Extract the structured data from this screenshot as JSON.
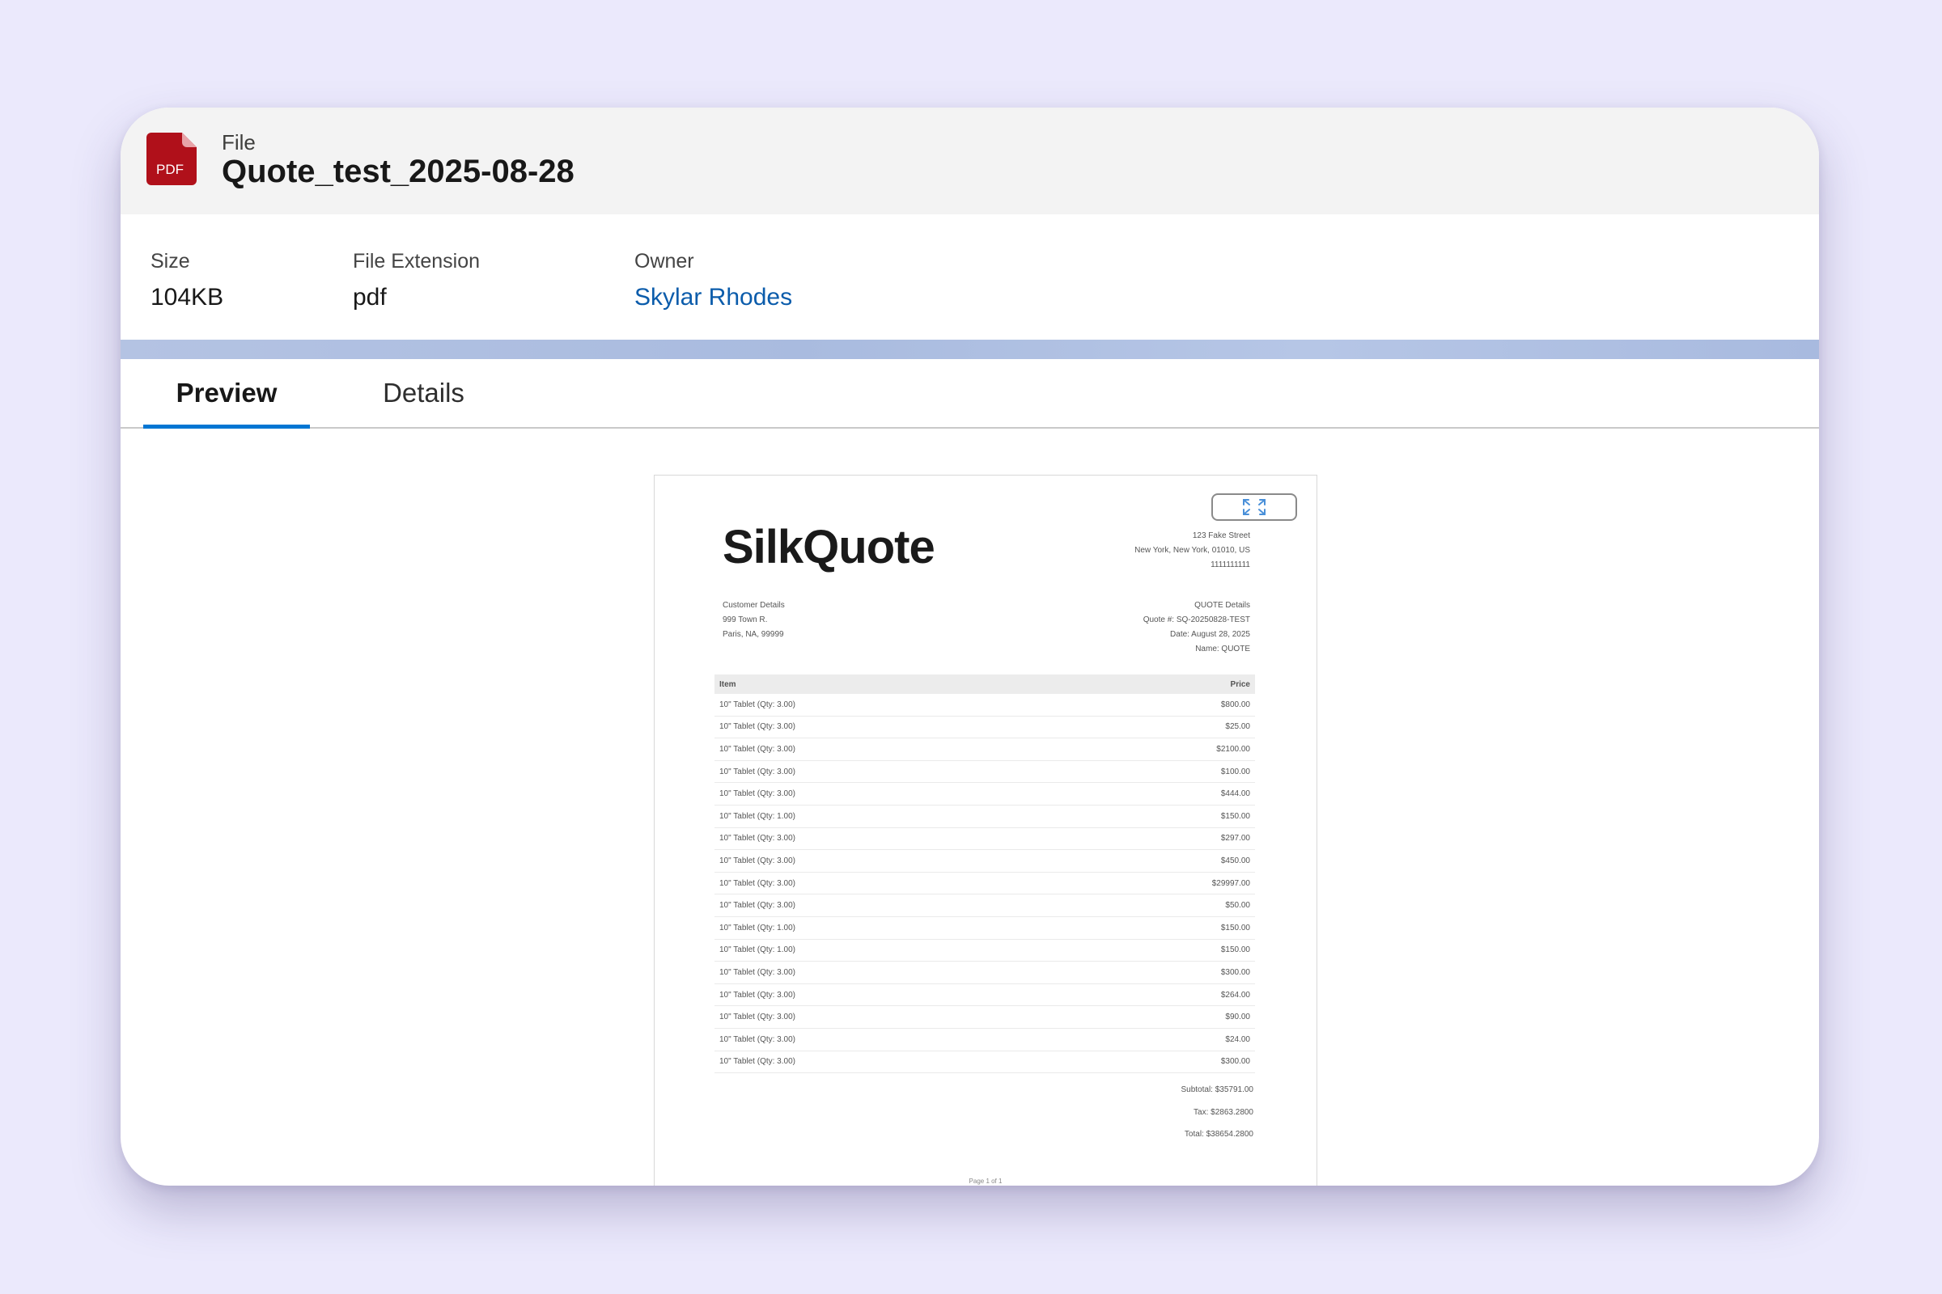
{
  "header": {
    "object_type": "File",
    "title": "Quote_test_2025-08-28",
    "icon": "pdf-file-icon",
    "icon_label": "PDF",
    "icon_color": "#b0101a"
  },
  "fields": [
    {
      "label": "Size",
      "value": "104KB"
    },
    {
      "label": "File Extension",
      "value": "pdf"
    },
    {
      "label": "Owner",
      "value": "Skylar Rhodes",
      "is_link": true
    }
  ],
  "tabs": [
    {
      "label": "Preview",
      "active": true
    },
    {
      "label": "Details",
      "active": false
    }
  ],
  "accent_color": "#0176d3",
  "preview": {
    "brand": "SilkQuote",
    "company_address": [
      "123 Fake Street",
      "New York, New York, 01010, US",
      "1111111111"
    ],
    "customer": [
      "Customer Details",
      "999 Town R.",
      "Paris, NA, 99999"
    ],
    "quote_details": [
      "QUOTE Details",
      "Quote #: SQ-20250828-TEST",
      "Date: August 28, 2025",
      "Name: QUOTE"
    ],
    "columns": [
      "Item",
      "Price"
    ],
    "items": [
      {
        "item": "10\" Tablet (Qty: 3.00)",
        "price": "$800.00"
      },
      {
        "item": "10\" Tablet (Qty: 3.00)",
        "price": "$25.00"
      },
      {
        "item": "10\" Tablet (Qty: 3.00)",
        "price": "$2100.00"
      },
      {
        "item": "10\" Tablet (Qty: 3.00)",
        "price": "$100.00"
      },
      {
        "item": "10\" Tablet (Qty: 3.00)",
        "price": "$444.00"
      },
      {
        "item": "10\" Tablet (Qty: 1.00)",
        "price": "$150.00"
      },
      {
        "item": "10\" Tablet (Qty: 3.00)",
        "price": "$297.00"
      },
      {
        "item": "10\" Tablet (Qty: 3.00)",
        "price": "$450.00"
      },
      {
        "item": "10\" Tablet (Qty: 3.00)",
        "price": "$29997.00"
      },
      {
        "item": "10\" Tablet (Qty: 3.00)",
        "price": "$50.00"
      },
      {
        "item": "10\" Tablet (Qty: 1.00)",
        "price": "$150.00"
      },
      {
        "item": "10\" Tablet (Qty: 1.00)",
        "price": "$150.00"
      },
      {
        "item": "10\" Tablet (Qty: 3.00)",
        "price": "$300.00"
      },
      {
        "item": "10\" Tablet (Qty: 3.00)",
        "price": "$264.00"
      },
      {
        "item": "10\" Tablet (Qty: 3.00)",
        "price": "$90.00"
      },
      {
        "item": "10\" Tablet (Qty: 3.00)",
        "price": "$24.00"
      },
      {
        "item": "10\" Tablet (Qty: 3.00)",
        "price": "$300.00"
      }
    ],
    "subtotal": "Subtotal: $35791.00",
    "tax": "Tax: $2863.2800",
    "total": "Total: $38654.2800",
    "page_footer": "Page 1 of 1",
    "expand_icon": "expand-icon"
  }
}
